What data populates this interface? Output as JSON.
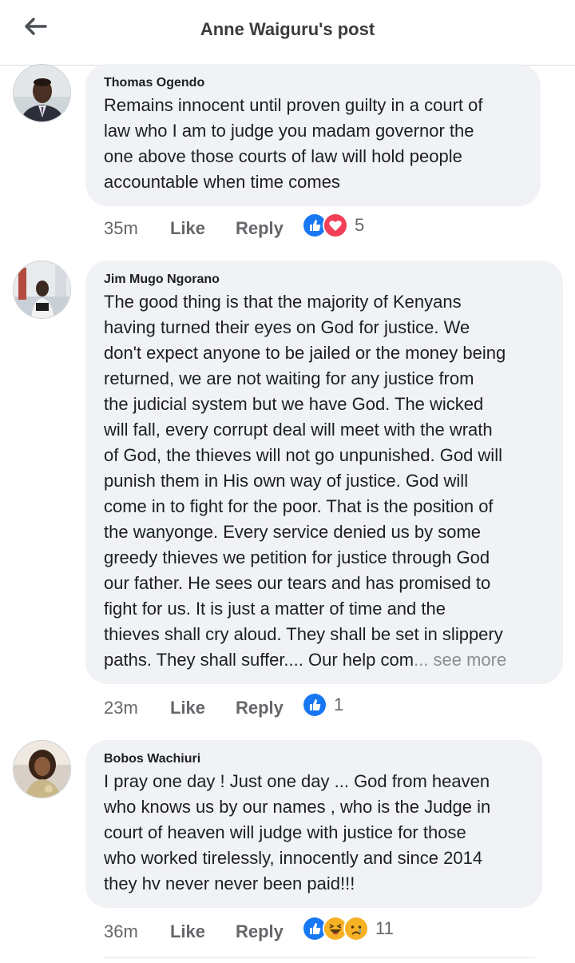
{
  "header": {
    "title": "Anne Waiguru's post",
    "back_icon": "arrow-left-icon"
  },
  "comments": [
    {
      "author": "Thomas Ogendo",
      "text": "Remains innocent until proven guilty in a court of\nlaw who I am to judge you madam governor the\none above those courts of law will hold people\naccountable when time comes",
      "time": "35m",
      "like_label": "Like",
      "reply_label": "Reply",
      "reactions": [
        "like-reaction-icon",
        "love-reaction-icon"
      ],
      "reaction_count": "5"
    },
    {
      "author": "Jim Mugo Ngorano",
      "text": "The good thing is that the majority of Kenyans\nhaving turned their eyes on God for justice. We\ndon't expect anyone to be jailed or the money being\nreturned, we are not waiting for any justice from\nthe judicial system but we have God. The wicked\nwill fall, every corrupt deal will meet with the wrath\nof God, the thieves will not go unpunished. God will\npunish them in His own way of justice. God will\ncome in to fight for the poor. That is the position of\nthe wanyonge. Every service denied us by some\ngreedy thieves we petition for justice through God\nour father. He sees our tears and has promised to\nfight for us. It is just a matter of time and the\nthieves shall cry aloud. They shall be set in slippery\npaths. They shall suffer.... Our help com",
      "see_more": "... see more",
      "time": "23m",
      "like_label": "Like",
      "reply_label": "Reply",
      "reactions": [
        "like-reaction-icon"
      ],
      "reaction_count": "1"
    },
    {
      "author": "Bobos Wachiuri",
      "text": "I pray one day ! Just one day ... God from heaven\nwho knows us by our names , who is the Judge in\ncourt of heaven will judge with justice for  those\nwho worked tirelessly, innocently and since 2014\nthey hv never never been paid!!!",
      "time": "36m",
      "like_label": "Like",
      "reply_label": "Reply",
      "reactions": [
        "like-reaction-icon",
        "haha-reaction-icon",
        "sad-reaction-icon"
      ],
      "reaction_count": "11"
    }
  ],
  "colors": {
    "like_blue": "#1877f2",
    "love_red": "#f33e58",
    "haha_yellow": "#f7b125",
    "bubble_bg": "#f0f2f5",
    "meta_gray": "#65676b"
  }
}
